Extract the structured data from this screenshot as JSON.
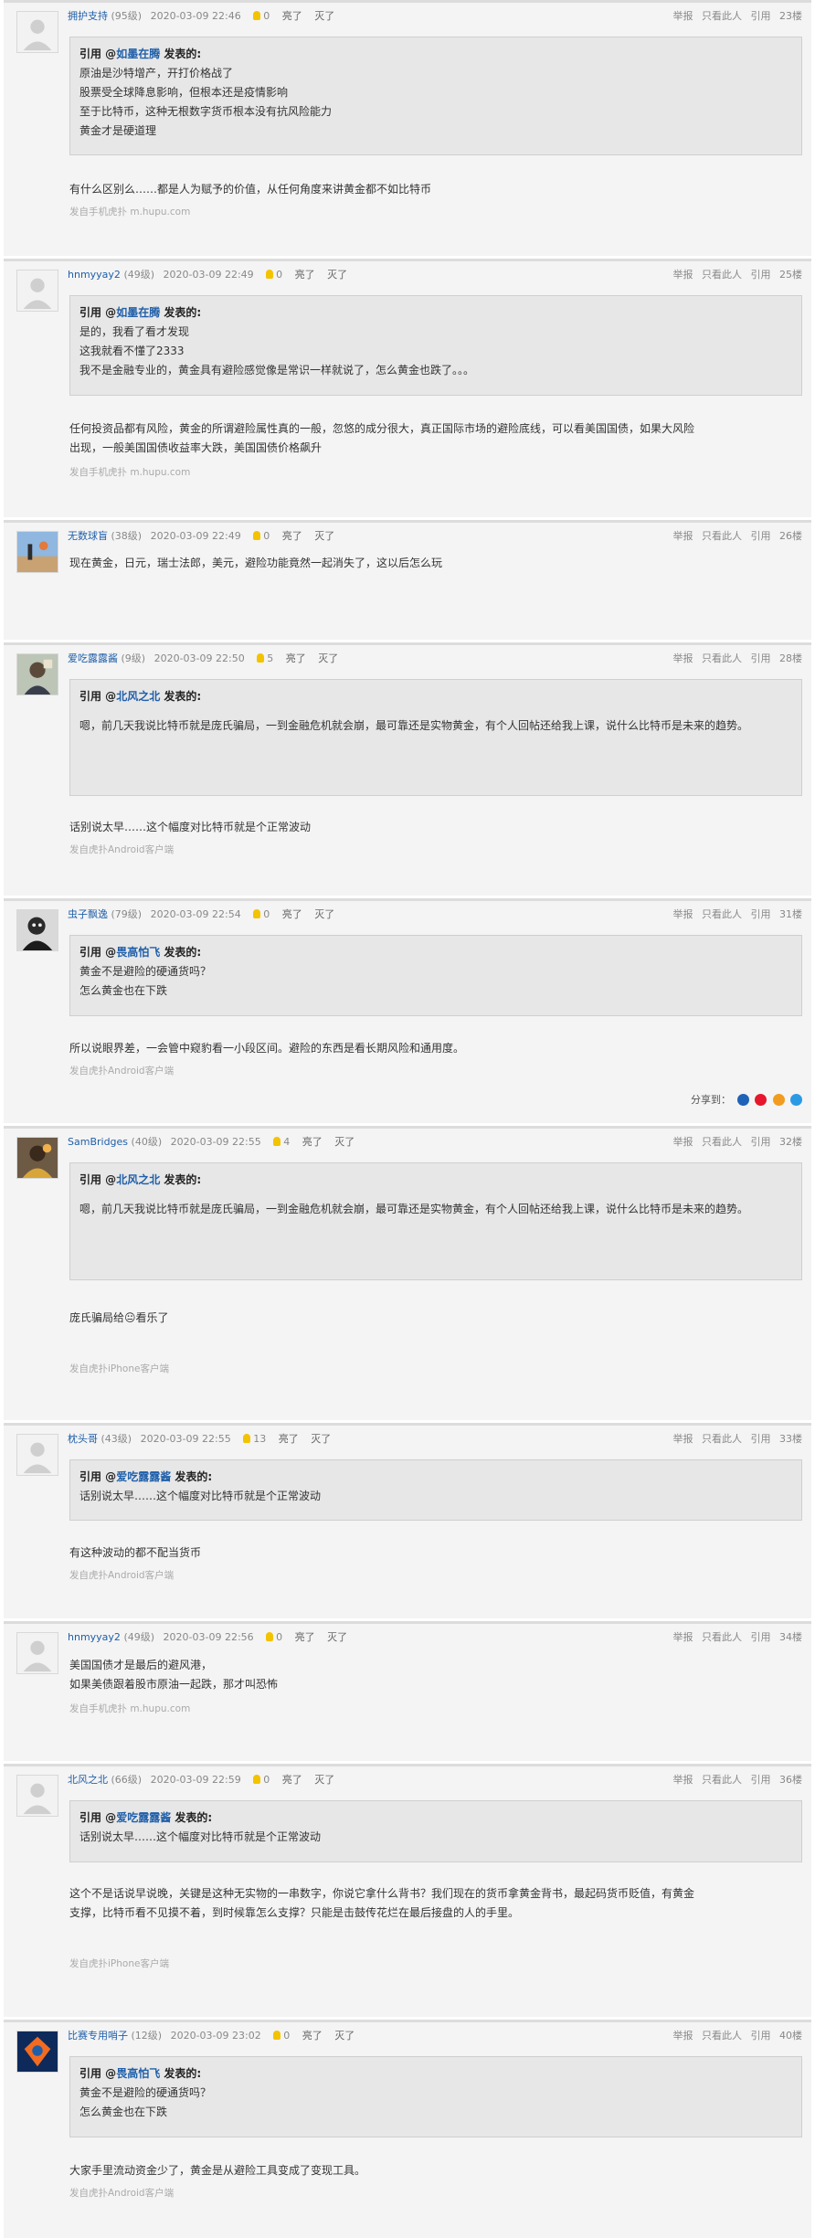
{
  "actions": {
    "report": "举报",
    "only_this": "只看此人",
    "quote": "引用",
    "light": "亮了",
    "dark": "灭了",
    "share_label": "分享到："
  },
  "quote_prefix": "引用 @",
  "quote_suffix": " 发表的:",
  "icons": {
    "bulb_color": "#f3c300",
    "share_icons": [
      "renren-icon",
      "weibo-icon",
      "douban-icon",
      "qq-icon"
    ]
  },
  "posts": [
    {
      "user": "拥护支持",
      "level": "(95级)",
      "time": "2020-03-09 22:46",
      "lights": "0",
      "floor": "23楼",
      "quote": {
        "user": "如墨在腾",
        "lines": [
          "原油是沙特增产，开打价格战了",
          "股票受全球降息影响，但根本还是疫情影响",
          "至于比特币，这种无根数字货币根本没有抗风险能力",
          "黄金才是硬道理"
        ]
      },
      "body": [
        "有什么区别么……都是人为赋予的价值，从任何角度来讲黄金都不如比特币"
      ],
      "source": "发自手机虎扑 m.hupu.com"
    },
    {
      "user": "hnmyyay2",
      "level": "(49级)",
      "time": "2020-03-09 22:49",
      "lights": "0",
      "floor": "25楼",
      "quote": {
        "user": "如墨在腾",
        "lines": [
          "是的，我看了看才发现",
          "这我就看不懂了2333",
          "我不是金融专业的，黄金具有避险感觉像是常识一样就说了，怎么黄金也跌了。。。"
        ]
      },
      "body": [
        "任何投资品都有风险，黄金的所谓避险属性真的一般，忽悠的成分很大，真正国际市场的避险底线，可以看美国国债，如果大风险",
        "出现，一般美国国债收益率大跌，美国国债价格飙升"
      ],
      "source": "发自手机虎扑 m.hupu.com"
    },
    {
      "user": "无数球盲",
      "level": "(38级)",
      "time": "2020-03-09 22:49",
      "lights": "0",
      "floor": "26楼",
      "body": [
        "现在黄金，日元，瑞士法郎，美元，避险功能竟然一起消失了，这以后怎么玩"
      ]
    },
    {
      "user": "爱吃露露酱",
      "level": "(9级)",
      "time": "2020-03-09 22:50",
      "lights": "5",
      "floor": "28楼",
      "quote": {
        "user": "北风之北",
        "lines": [
          "嗯，前几天我说比特币就是庞氏骗局，一到金融危机就会崩，最可靠还是实物黄金，有个人回帖还给我上课，说什么比特币是未来的趋势。"
        ]
      },
      "body": [
        "话别说太早……这个幅度对比特币就是个正常波动"
      ],
      "source": "发自虎扑Android客户端"
    },
    {
      "user": "虫子飘逸",
      "level": "(79级)",
      "time": "2020-03-09 22:54",
      "lights": "0",
      "floor": "31楼",
      "quote": {
        "user": "畏高怕飞",
        "lines": [
          "黄金不是避险的硬通货吗？",
          "怎么黄金也在下跌"
        ]
      },
      "body": [
        "所以说眼界差，一会管中窥豹看一小段区间。避险的东西是看长期风险和通用度。"
      ],
      "source": "发自虎扑Android客户端"
    },
    {
      "user": "SamBridges",
      "level": "(40级)",
      "time": "2020-03-09 22:55",
      "lights": "4",
      "floor": "32楼",
      "quote": {
        "user": "北风之北",
        "lines": [
          "嗯，前几天我说比特币就是庞氏骗局，一到金融危机就会崩，最可靠还是实物黄金，有个人回帖还给我上课，说什么比特币是未来的趋势。"
        ]
      },
      "body": [
        "庞氏骗局给😐看乐了"
      ],
      "source": "发自虎扑iPhone客户端"
    },
    {
      "user": "枕头哥",
      "level": "(43级)",
      "time": "2020-03-09 22:55",
      "lights": "13",
      "floor": "33楼",
      "quote": {
        "user": "爱吃露露酱",
        "lines": [
          "话别说太早……这个幅度对比特币就是个正常波动"
        ]
      },
      "body": [
        "有这种波动的都不配当货币"
      ],
      "source": "发自虎扑Android客户端"
    },
    {
      "user": "hnmyyay2",
      "level": "(49级)",
      "time": "2020-03-09 22:56",
      "lights": "0",
      "floor": "34楼",
      "body": [
        "美国国债才是最后的避风港，",
        "如果美债跟着股市原油一起跌，那才叫恐怖"
      ],
      "source": "发自手机虎扑 m.hupu.com"
    },
    {
      "user": "北风之北",
      "level": "(66级)",
      "time": "2020-03-09 22:59",
      "lights": "0",
      "floor": "36楼",
      "quote": {
        "user": "爱吃露露酱",
        "lines": [
          "话别说太早……这个幅度对比特币就是个正常波动"
        ]
      },
      "body": [
        "这个不是话说早说晚，关键是这种无实物的一串数字，你说它拿什么背书？我们现在的货币拿黄金背书，最起码货币贬值，有黄金",
        "支撑，比特币看不见摸不着，到时候靠怎么支撑？只能是击鼓传花烂在最后接盘的人的手里。"
      ],
      "source": "发自虎扑iPhone客户端"
    },
    {
      "user": "比赛专用哨子",
      "level": "(12级)",
      "time": "2020-03-09 23:02",
      "lights": "0",
      "floor": "40楼",
      "quote": {
        "user": "畏高怕飞",
        "lines": [
          "黄金不是避险的硬通货吗？",
          "怎么黄金也在下跌"
        ]
      },
      "body": [
        "大家手里流动资金少了，黄金是从避险工具变成了变现工具。"
      ],
      "source": "发自虎扑Android客户端"
    }
  ]
}
